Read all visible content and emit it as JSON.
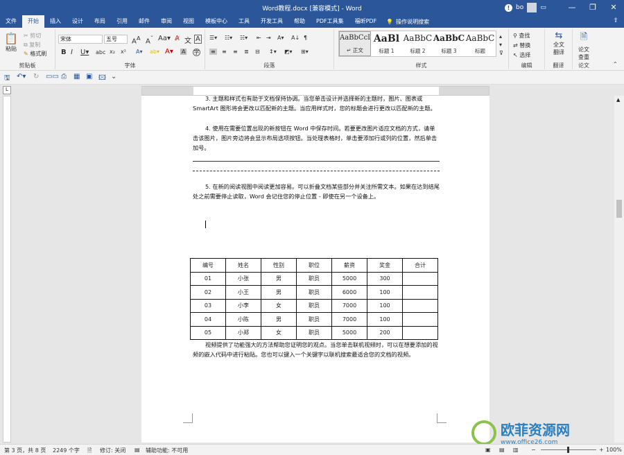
{
  "window": {
    "title": "Word教程.docx [兼容模式]  -  Word",
    "user": "bo",
    "min": "—",
    "restore": "❐",
    "close": "✕"
  },
  "tabs": [
    "文件",
    "开始",
    "插入",
    "设计",
    "布局",
    "引用",
    "邮件",
    "审阅",
    "视图",
    "模板中心",
    "工具",
    "开发工具",
    "帮助",
    "PDF工具集",
    "福昕PDF"
  ],
  "search_label": "操作说明搜索",
  "ribbon": {
    "clipboard": {
      "paste": "粘贴",
      "cut": "剪切",
      "copy": "复制",
      "format_painter": "格式刷",
      "group": "剪贴板"
    },
    "font": {
      "name": "宋体",
      "size": "五号",
      "group": "字体"
    },
    "paragraph": {
      "group": "段落"
    },
    "styles": {
      "group": "样式",
      "items": [
        {
          "preview": "AaBbCcI",
          "name": "↵ 正文"
        },
        {
          "preview": "AaBl",
          "name": "标题 1"
        },
        {
          "preview": "AaBbC",
          "name": "标题 2"
        },
        {
          "preview": "AaBbC",
          "name": "标题 3"
        },
        {
          "preview": "AaBbC",
          "name": "标题"
        }
      ]
    },
    "editing": {
      "find": "查找",
      "replace": "替换",
      "select": "选择",
      "group": "编辑"
    },
    "translate": {
      "label1": "全文",
      "label2": "翻译",
      "group": "翻译"
    },
    "check": {
      "label1": "论文",
      "label2": "查重",
      "group": "论文"
    }
  },
  "document": {
    "para_top": "3. 主题和样式也有助于文档保持协调。当您单击设计并选择新的主题时，图片、图表或 SmartArt 图形将会更改以匹配新的主题。当应用样式时，您的标题会进行更改以匹配新的主题。",
    "para4": "4. 使用在需要位置出现的新按钮在 Word 中保存时间。若要更改图片适应文档的方式，请单击该图片，图片旁边将会显示布局选项按钮。当处理表格时，单击要添加行或列的位置，然后单击加号。",
    "para5": "5. 在新的阅读视图中阅读更加容易。可以折叠文档某些部分并关注所需文本。如果在达到结尾处之前需要停止读取，Word 会记住您的停止位置 - 即使在另一个设备上。",
    "para_bottom": "视频提供了功能强大的方法帮助您证明您的观点。当您单击联机视频时，可以在想要添加的视频的嵌入代码中进行粘贴。您也可以键入一个关键字以联机搜索最适合您的文档的视频。",
    "table": {
      "headers": [
        "编号",
        "姓名",
        "性别",
        "职位",
        "薪资",
        "奖金",
        "合计"
      ],
      "rows": [
        [
          "01",
          "小张",
          "男",
          "职员",
          "5000",
          "300",
          ""
        ],
        [
          "02",
          "小王",
          "男",
          "职员",
          "6000",
          "100",
          ""
        ],
        [
          "03",
          "小李",
          "女",
          "职员",
          "7000",
          "100",
          ""
        ],
        [
          "04",
          "小陈",
          "男",
          "职员",
          "7000",
          "100",
          ""
        ],
        [
          "05",
          "小郑",
          "女",
          "职员",
          "5000",
          "200",
          ""
        ]
      ]
    }
  },
  "status": {
    "page": "第 3 页，共 8 页",
    "words": "2249 个字",
    "track": "修订: 关闭",
    "accessibility": "辅助功能: 不可用",
    "zoom": "100%"
  },
  "watermark": {
    "title": "欧菲资源网",
    "url": "www.office26.com"
  },
  "colors": {
    "titlebar": "#2b579a",
    "ribbon": "#f3f3f3",
    "background": "#e6e6e6"
  }
}
